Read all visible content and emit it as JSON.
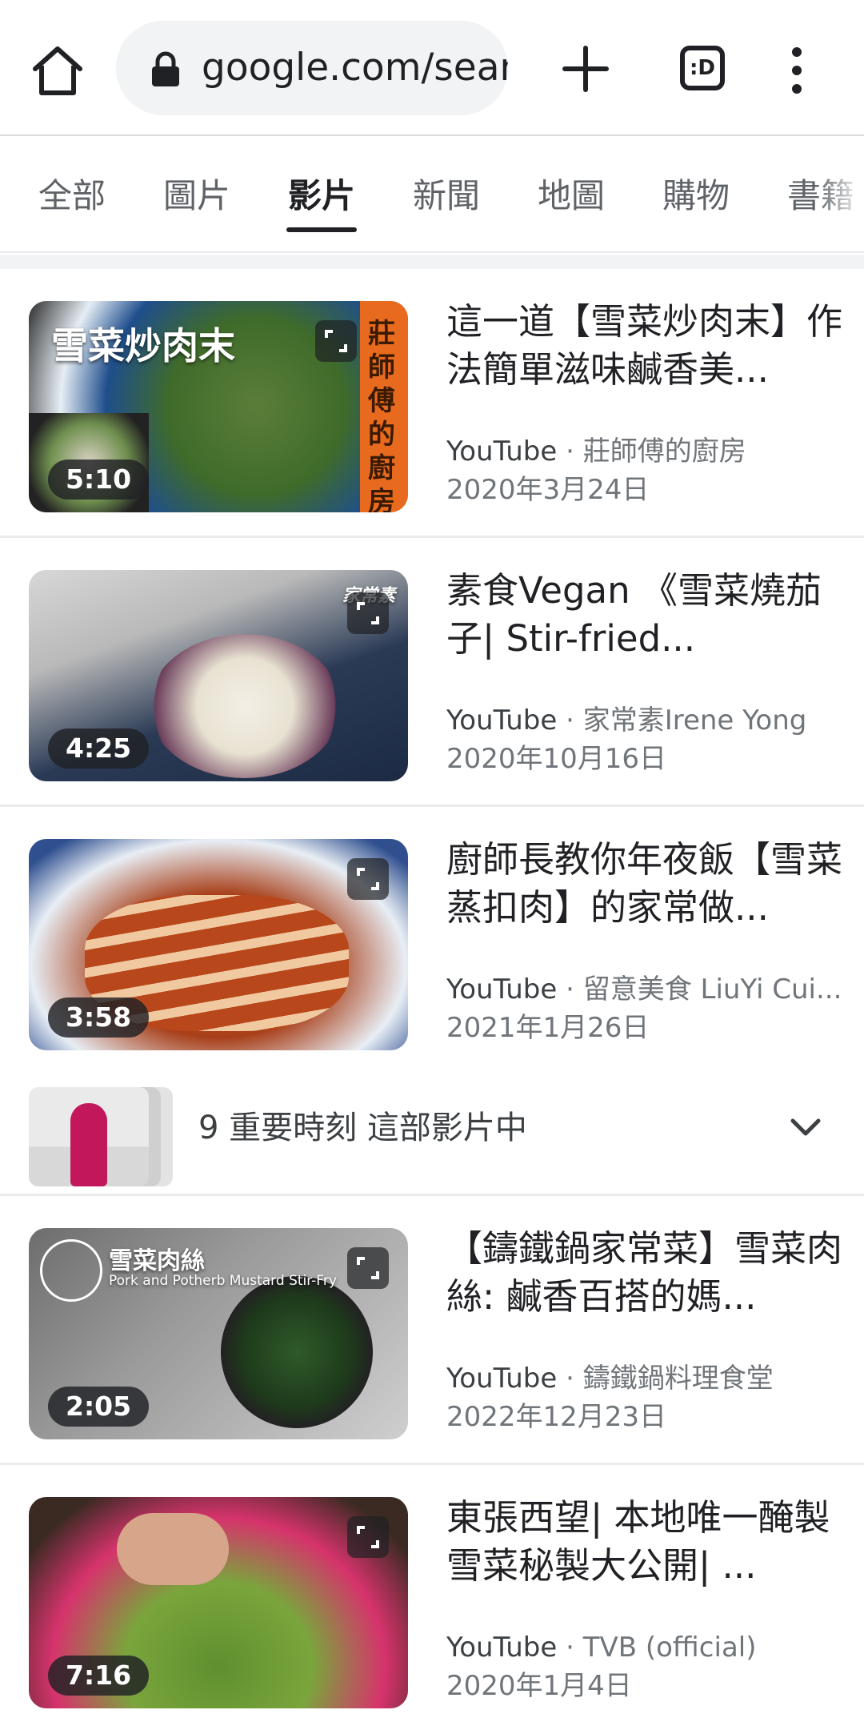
{
  "browser": {
    "url": "google.com/search",
    "tabs_button_label": ":D"
  },
  "search_tabs": [
    "全部",
    "圖片",
    "影片",
    "新聞",
    "地圖",
    "購物",
    "書籍"
  ],
  "active_tab_index": 2,
  "results": [
    {
      "title": "這一道【雪菜炒肉末】作法簡單滋味鹹香美...",
      "source": "YouTube",
      "channel": "莊師傅的廚房",
      "date": "2020年3月24日",
      "duration": "5:10",
      "thumb_caption": "雪菜炒肉末",
      "thumb_side_caption": "莊師傅的廚房"
    },
    {
      "title": "素食Vegan 《雪菜燒茄子| Stir-fried...",
      "source": "YouTube",
      "channel": "家常素Irene Yong",
      "date": "2020年10月16日",
      "duration": "4:25",
      "thumb_caption": "家常素"
    },
    {
      "title": "廚師長教你年夜飯【雪菜蒸扣肉】的家常做...",
      "source": "YouTube",
      "channel": "留意美食 LiuYi Cui...",
      "date": "2021年1月26日",
      "duration": "3:58",
      "key_moments": "9 重要時刻 這部影片中"
    },
    {
      "title": "【鑄鐵鍋家常菜】雪菜肉絲: 鹹香百搭的媽...",
      "source": "YouTube",
      "channel": "鑄鐵鍋料理食堂",
      "date": "2022年12月23日",
      "duration": "2:05",
      "thumb_caption": "雪菜肉絲",
      "thumb_subcaption": "Pork and Potherb Mustard Stir-Fry"
    },
    {
      "title": "東張西望| 本地唯一醃製雪菜秘製大公開| ...",
      "source": "YouTube",
      "channel": "TVB (official)",
      "date": "2020年1月4日",
      "duration": "7:16"
    }
  ],
  "colors": {
    "text_primary": "#202124",
    "text_secondary": "#70757a",
    "omnibox_bg": "#f1f3f4"
  },
  "icons": [
    "home-icon",
    "lock-icon",
    "plus-icon",
    "tab-switcher-icon",
    "more-vert-icon",
    "expand-icon",
    "chevron-down-icon"
  ]
}
